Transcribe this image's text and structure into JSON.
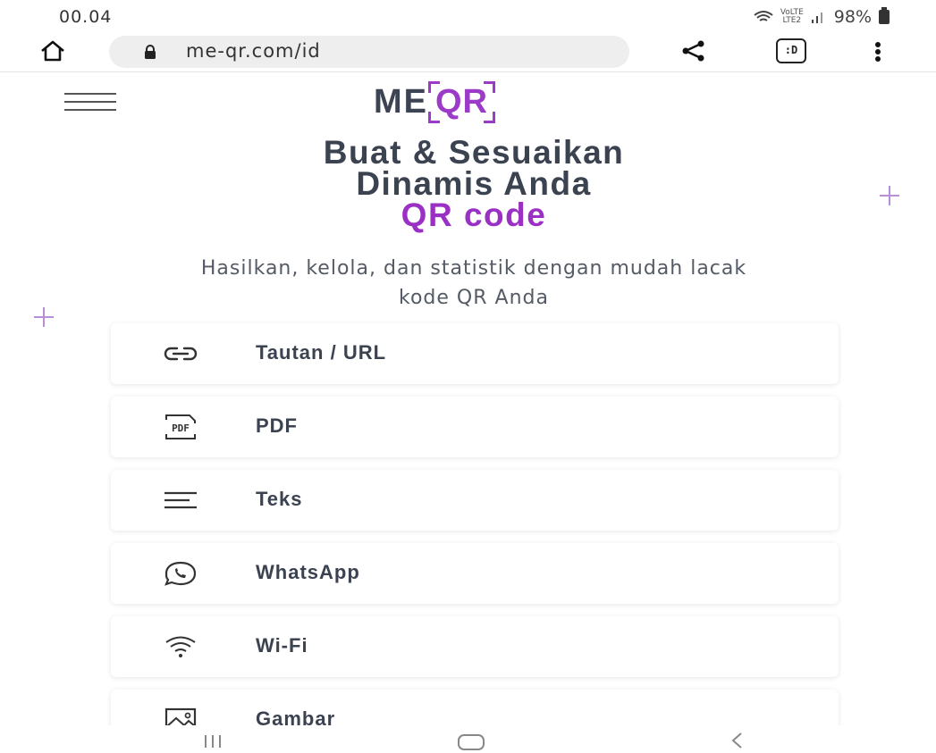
{
  "status_bar": {
    "time": "00.04",
    "network_label_top": "VoLTE",
    "network_label_bottom": "LTE2",
    "battery": "98%"
  },
  "browser": {
    "url": "me-qr.com/id",
    "dex_label": ":D"
  },
  "site": {
    "logo_me": "ME",
    "logo_qr": "QR",
    "title_line1": "Buat & Sesuaikan",
    "title_line2": "Dinamis Anda",
    "title_accent": "QR code",
    "subtitle_line1": "Hasilkan, kelola, dan statistik dengan mudah lacak",
    "subtitle_line2": "kode QR Anda"
  },
  "qr_types": [
    {
      "label": "Tautan / URL",
      "icon": "link-icon"
    },
    {
      "label": "PDF",
      "icon": "pdf-icon"
    },
    {
      "label": "Teks",
      "icon": "text-icon"
    },
    {
      "label": "WhatsApp",
      "icon": "whatsapp-icon"
    },
    {
      "label": "Wi-Fi",
      "icon": "wifi-icon"
    },
    {
      "label": "Gambar",
      "icon": "image-icon"
    }
  ],
  "colors": {
    "accent": "#9b30c4",
    "text": "#3b4250",
    "deco": "#b88fd6"
  }
}
